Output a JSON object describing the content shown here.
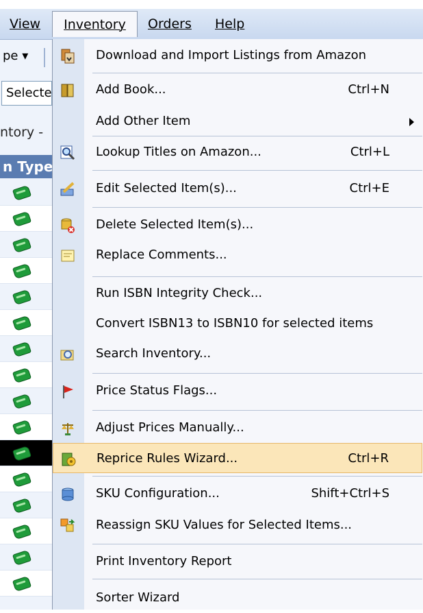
{
  "menubar": {
    "view": "View",
    "inventory": "Inventory",
    "orders": "Orders",
    "help": "Help"
  },
  "background": {
    "toolbar_button": "pe ▾",
    "select_text": "Selecte",
    "inventory_label": "ntory -",
    "column_header": "n Type",
    "selected_row_index": 10,
    "row_count": 16
  },
  "menu": {
    "items": [
      {
        "label": "Download and Import Listings from Amazon",
        "shortcut": "",
        "icon": "amazon-download-icon"
      },
      {
        "label": "Add Book...",
        "shortcut": "Ctrl+N",
        "icon": "book-icon"
      },
      {
        "label": "Add Other Item",
        "shortcut": "",
        "icon": "",
        "submenu": true
      },
      {
        "label": "Lookup Titles on Amazon...",
        "shortcut": "Ctrl+L",
        "icon": "magnifier-icon"
      },
      {
        "label": "Edit Selected Item(s)...",
        "shortcut": "Ctrl+E",
        "icon": "pencil-icon"
      },
      {
        "label": "Delete Selected Item(s)...",
        "shortcut": "",
        "icon": "delete-icon"
      },
      {
        "label": "Replace Comments...",
        "shortcut": "",
        "icon": "note-icon"
      },
      {
        "label": "Run ISBN Integrity Check...",
        "shortcut": "",
        "icon": ""
      },
      {
        "label": "Convert ISBN13 to ISBN10 for selected items",
        "shortcut": "",
        "icon": ""
      },
      {
        "label": "Search Inventory...",
        "shortcut": "",
        "icon": "search-folder-icon"
      },
      {
        "label": "Price Status Flags...",
        "shortcut": "",
        "icon": "red-flag-icon"
      },
      {
        "label": "Adjust Prices Manually...",
        "shortcut": "",
        "icon": "scale-icon"
      },
      {
        "label": "Reprice Rules Wizard...",
        "shortcut": "Ctrl+R",
        "icon": "wizard-icon",
        "highlighted": true
      },
      {
        "label": "SKU Configuration...",
        "shortcut": "Shift+Ctrl+S",
        "icon": "database-icon"
      },
      {
        "label": "Reassign SKU Values for Selected Items...",
        "shortcut": "",
        "icon": "reassign-icon"
      },
      {
        "label": "Print Inventory Report",
        "shortcut": "",
        "icon": ""
      },
      {
        "label": "Sorter Wizard",
        "shortcut": "",
        "icon": ""
      }
    ]
  },
  "colors": {
    "menu_bg": "#f6f7fb",
    "gutter": "#dde6f3",
    "highlight": "#fbe6b9",
    "highlight_border": "#e7b768",
    "column_header": "#5a7cb1"
  }
}
